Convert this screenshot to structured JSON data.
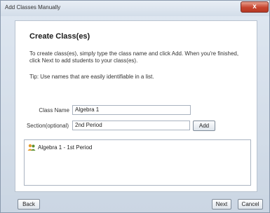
{
  "window": {
    "title": "Add Classes Manually",
    "close_label": "x"
  },
  "page": {
    "heading": "Create Class(es)",
    "description": "To create class(es), simply type the class name and click Add. When you're finished, click Next to add students to your class(es).",
    "tip": "Tip: Use names that are easily identifiable in a list."
  },
  "form": {
    "class_name_label": "Class Name",
    "class_name_value": "Algebra 1",
    "section_label": "Section(optional)",
    "section_value": "2nd Period",
    "add_label": "Add"
  },
  "class_list": {
    "items": [
      {
        "label": "Algebra 1 - 1st Period",
        "icon": "group-people-icon"
      }
    ]
  },
  "footer": {
    "back_label": "Back",
    "next_label": "Next",
    "cancel_label": "Cancel"
  }
}
